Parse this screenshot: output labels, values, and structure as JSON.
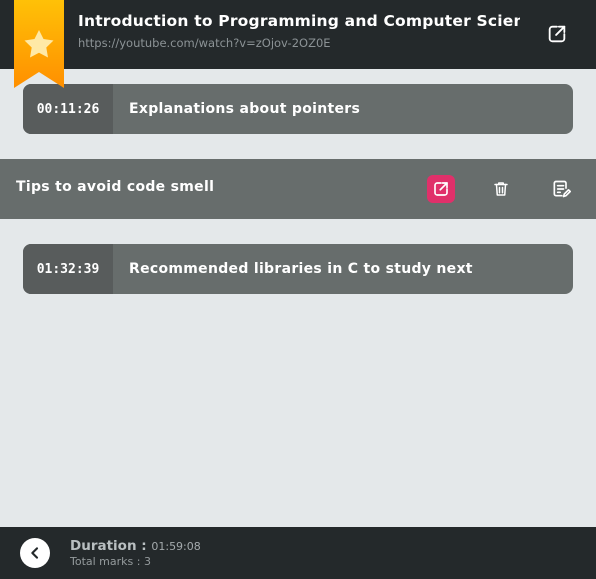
{
  "header": {
    "title": "Introduction to Programming and Computer Science - Full Course",
    "url": "https://youtube.com/watch?v=zOjov-2OZ0E",
    "open_icon": "external-link-icon",
    "ribbon_icon": "star-bookmark-icon"
  },
  "marks": [
    {
      "timestamp": "00:11:26",
      "label": "Explanations about pointers"
    },
    {
      "label": "Tips to avoid code smell",
      "actions": [
        "external-link-icon",
        "trash-icon",
        "edit-note-icon"
      ]
    },
    {
      "timestamp": "01:32:39",
      "label": "Recommended libraries in C to study next"
    }
  ],
  "footer": {
    "duration_label": "Duration :",
    "duration_value": "01:59:08",
    "total_marks": "Total marks : 3",
    "back_icon": "chevron-left-icon"
  },
  "colors": {
    "header_bg": "#24292b",
    "page_bg": "#e4e8ea",
    "card_bg": "#676d6c",
    "timestamp_bg": "#585c5c",
    "accent": "#e0306a",
    "ribbon": "#ffb300"
  }
}
